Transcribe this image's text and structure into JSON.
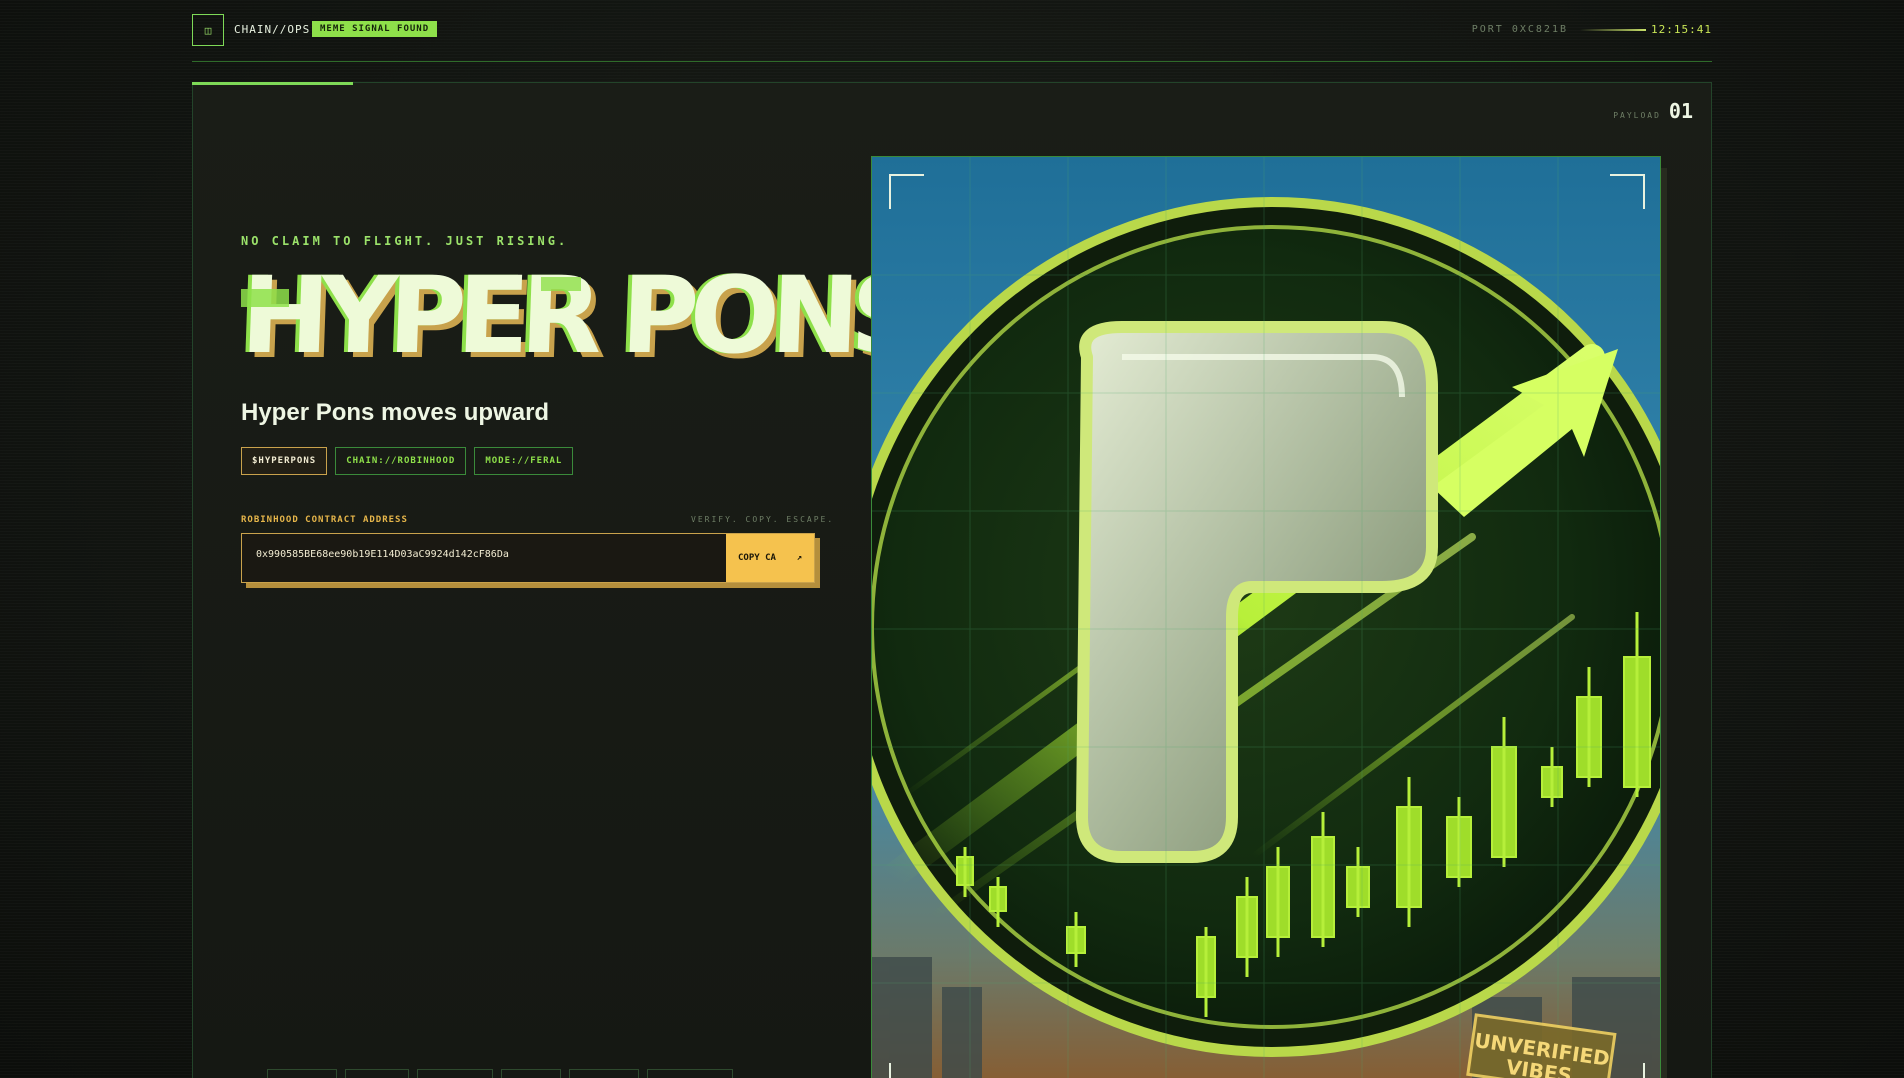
{
  "topbar": {
    "menu_icon": "grid-icon",
    "brand": "CHAIN//OPS",
    "signal_badge": "MEME SIGNAL FOUND",
    "port": "PORT 0XC821B",
    "clock": "12:15:41"
  },
  "panel": {
    "payload_label": "PAYLOAD",
    "payload_number": "01",
    "tagline": "NO CLAIM TO FLIGHT. JUST RISING.",
    "title": "HYPER PONS",
    "subtitle": "Hyper Pons moves upward",
    "chips": [
      "$HYPERPONS",
      "CHAIN://ROBINHOOD",
      "MODE://FERAL"
    ],
    "contract": {
      "label": "ROBINHOOD CONTRACT ADDRESS",
      "hint": "VERIFY. COPY. ESCAPE.",
      "address": "0x990585BE68ee90b19E114D03aC9924d142cF86Da",
      "copy_label": "COPY CA",
      "copy_icon": "arrow-up-right-icon"
    }
  },
  "artwork": {
    "stamp": "UNVERIFIED VIBES",
    "colors": {
      "accent": "#8ee04a",
      "gold": "#f5c24e",
      "sky": "#2e7fa8"
    }
  }
}
